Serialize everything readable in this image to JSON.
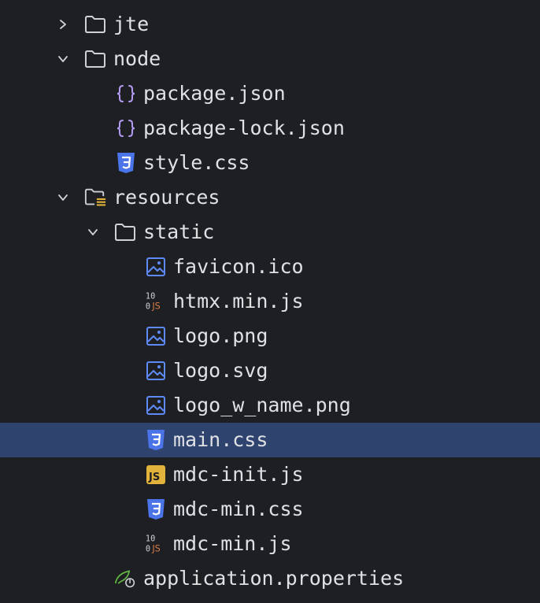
{
  "colors": {
    "background": "#1e1f22",
    "selection": "#2e436e",
    "text": "#dfe1e5",
    "folder_icon": "#ced0d6",
    "json_icon": "#b39bf2",
    "css_icon": "#4a74e8",
    "image_icon": "#5d8af7",
    "js_yellow": "#e2b33b",
    "js_orange": "#d87c4a",
    "spring_green": "#62b543"
  },
  "tree": [
    {
      "label": "jte",
      "icon": "folder-icon",
      "expander": "chevron-right-icon"
    },
    {
      "label": "node",
      "icon": "folder-icon",
      "expander": "chevron-down-icon"
    },
    {
      "label": "package.json",
      "icon": "json-icon"
    },
    {
      "label": "package-lock.json",
      "icon": "json-icon"
    },
    {
      "label": "style.css",
      "icon": "css-icon"
    },
    {
      "label": "resources",
      "icon": "resources-folder-icon",
      "expander": "chevron-down-icon"
    },
    {
      "label": "static",
      "icon": "folder-icon",
      "expander": "chevron-down-icon"
    },
    {
      "label": "favicon.ico",
      "icon": "image-icon"
    },
    {
      "label": "htmx.min.js",
      "icon": "minified-js-icon"
    },
    {
      "label": "logo.png",
      "icon": "image-icon"
    },
    {
      "label": "logo.svg",
      "icon": "image-icon"
    },
    {
      "label": "logo_w_name.png",
      "icon": "image-icon"
    },
    {
      "label": "main.css",
      "icon": "css-icon",
      "selected": true
    },
    {
      "label": "mdc-init.js",
      "icon": "javascript-icon"
    },
    {
      "label": "mdc-min.css",
      "icon": "css-icon"
    },
    {
      "label": "mdc-min.js",
      "icon": "minified-js-icon"
    },
    {
      "label": "application.properties",
      "icon": "spring-properties-icon"
    }
  ]
}
